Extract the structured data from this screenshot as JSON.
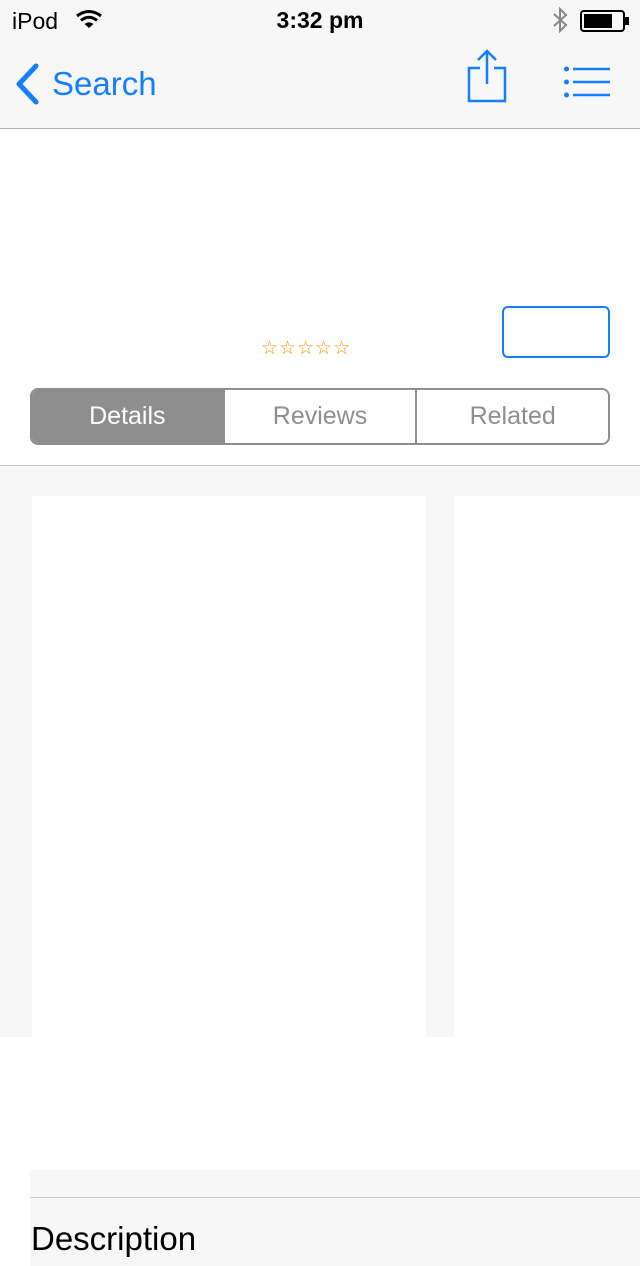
{
  "status_bar": {
    "carrier": "iPod",
    "time": "3:32 pm"
  },
  "nav": {
    "back_label": "Search",
    "accent_color": "#147efb"
  },
  "header": {
    "rating_stars": "☆☆☆☆☆",
    "rating_color": "#ff9500",
    "get_button_label": ""
  },
  "tabs": [
    {
      "label": "Details",
      "selected": true
    },
    {
      "label": "Reviews",
      "selected": false
    },
    {
      "label": "Related",
      "selected": false
    }
  ],
  "description": {
    "title": "Description"
  }
}
